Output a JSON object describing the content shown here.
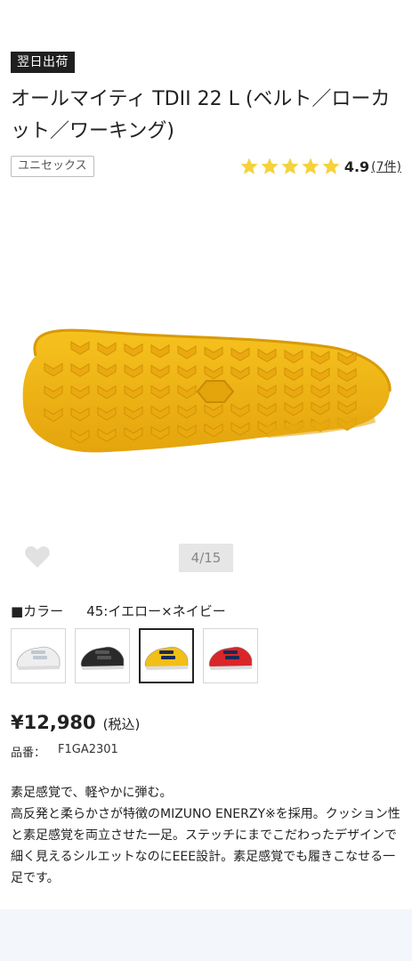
{
  "product": {
    "badge": "翌日出荷",
    "title": "オールマイティ TDII 22 L (ベルト／ローカット／ワーキング)",
    "unisex_tag": "ユニセックス",
    "rating": {
      "stars": 5,
      "score": "4.9",
      "count_label": "(7件)"
    },
    "star_color": "#f5d23b"
  },
  "gallery": {
    "counter": "4/15",
    "sole_color": "#f2b512"
  },
  "color": {
    "label": "■カラー",
    "selected": "45:イエロー×ネイビー",
    "swatches": [
      {
        "name": "white",
        "color": "#eeeeee"
      },
      {
        "name": "black",
        "color": "#2a2a2a"
      },
      {
        "name": "yellow",
        "color": "#f2bf17"
      },
      {
        "name": "red",
        "color": "#d8262a"
      }
    ]
  },
  "price": {
    "amount": "¥12,980",
    "tax_label": "(税込)"
  },
  "sku": {
    "label": "品番：",
    "value": "F1GA2301"
  },
  "description": [
    "素足感覚で、軽やかに弾む。",
    "高反発と柔らかさが特徴のMIZUNO ENERZY※を採用。クッション性と素足感覚を両立させた一足。ステッチにまでこだわったデザインで細く見えるシルエットなのにEEE設計。素足感覚でも履きこなせる一足です。"
  ]
}
